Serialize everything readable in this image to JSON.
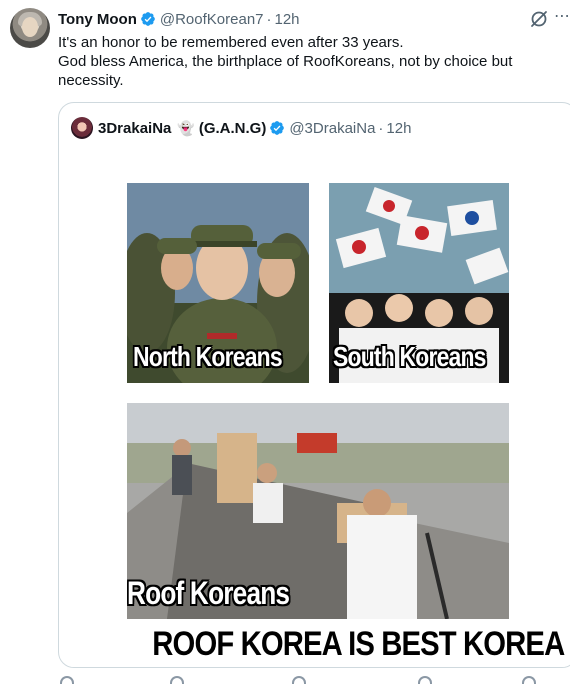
{
  "tweet": {
    "author_name": "Tony Moon",
    "handle": "@RoofKorean7",
    "separator": "·",
    "time": "12h",
    "text_line1": "It's an honor to be remembered even after 33 years.",
    "text_line2": "God bless America, the birthplace of RoofKoreans, not by choice but necessity."
  },
  "quote": {
    "author_name": "3DrakaiNa",
    "emoji": "👻",
    "group": "(G.A.N.G)",
    "handle": "@3DrakaiNa",
    "separator": "·",
    "time": "12h"
  },
  "meme": {
    "panel1_caption": "North Koreans",
    "panel2_caption": "South Koreans",
    "panel3_caption": "Roof Koreans",
    "bottom_caption": "ROOF KOREA IS BEST KOREA"
  },
  "colors": {
    "verified": "#1d9bf0",
    "text": "#0f1419",
    "muted": "#536471",
    "border": "#cfd9de"
  },
  "icons": [
    "verified-badge-icon",
    "grok-icon",
    "more-icon"
  ]
}
